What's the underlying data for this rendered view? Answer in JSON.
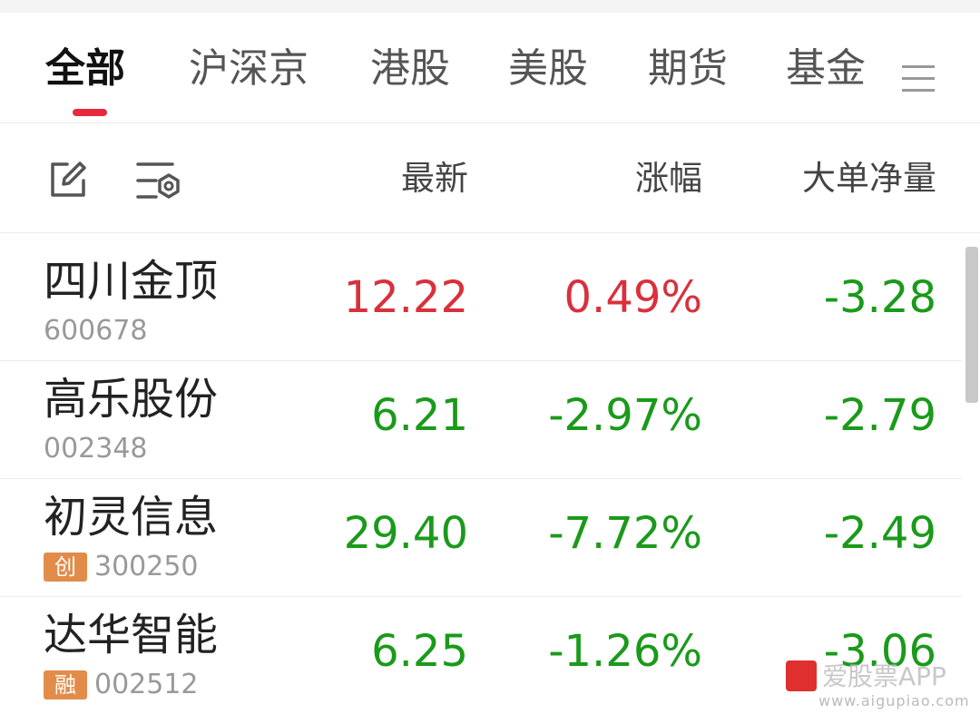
{
  "tabs": [
    {
      "label": "全部",
      "active": true
    },
    {
      "label": "沪深京",
      "active": false
    },
    {
      "label": "港股",
      "active": false
    },
    {
      "label": "美股",
      "active": false
    },
    {
      "label": "期货",
      "active": false
    },
    {
      "label": "基金",
      "active": false
    }
  ],
  "icons": {
    "menu": "menu-icon",
    "edit": "edit-icon",
    "filter": "filter-settings-icon"
  },
  "columns": {
    "latest": "最新",
    "change": "涨幅",
    "net_flow": "大单净量"
  },
  "stocks": [
    {
      "name": "四川金顶",
      "code": "600678",
      "badge": "",
      "latest": "12.22",
      "change": "0.49%",
      "net_flow": "-3.28",
      "trend": "up"
    },
    {
      "name": "高乐股份",
      "code": "002348",
      "badge": "",
      "latest": "6.21",
      "change": "-2.97%",
      "net_flow": "-2.79",
      "trend": "down"
    },
    {
      "name": "初灵信息",
      "code": "300250",
      "badge": "创",
      "latest": "29.40",
      "change": "-7.72%",
      "net_flow": "-2.49",
      "trend": "down"
    },
    {
      "name": "达华智能",
      "code": "002512",
      "badge": "融",
      "latest": "6.25",
      "change": "-1.26%",
      "net_flow": "-3.06",
      "trend": "down"
    }
  ],
  "colors": {
    "up": "#d9303b",
    "down": "#1a9a1a",
    "accent": "#e8293d",
    "badge": "#e28c4a"
  },
  "watermark": {
    "text": "爱股票APP",
    "url": "www.aigupiao.com"
  }
}
